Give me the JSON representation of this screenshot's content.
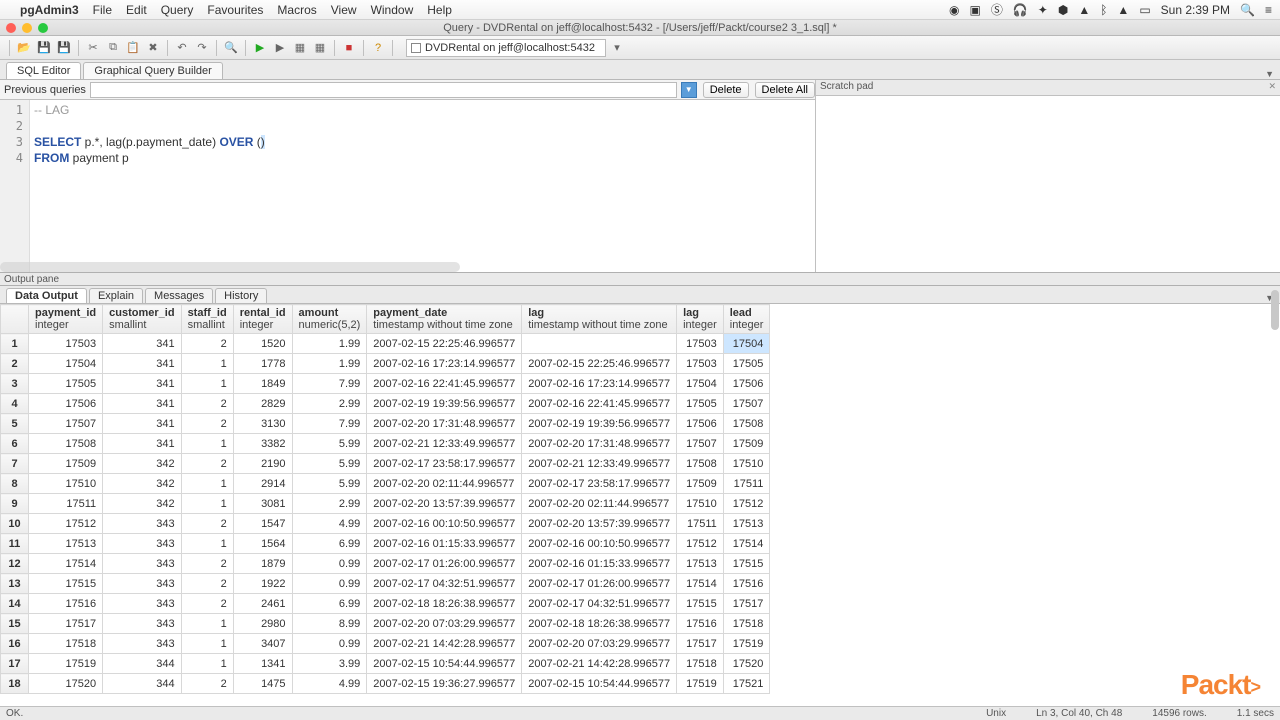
{
  "menubar": {
    "app": "pgAdmin3",
    "items": [
      "File",
      "Edit",
      "Query",
      "Favourites",
      "Macros",
      "View",
      "Window",
      "Help"
    ],
    "clock": "Sun 2:39 PM"
  },
  "window": {
    "title": "Query - DVDRental on jeff@localhost:5432 - [/Users/jeff/Packt/course2 3_1.sql] *"
  },
  "db_selector": "DVDRental on jeff@localhost:5432",
  "editor_tabs": {
    "sql": "SQL Editor",
    "gqb": "Graphical Query Builder"
  },
  "prev": {
    "label": "Previous queries",
    "delete": "Delete",
    "delete_all": "Delete All"
  },
  "code": {
    "l1": "-- LAG",
    "l2": "",
    "l3a": "SELECT",
    "l3b": " p.*, lag(p.payment_date) ",
    "l3c": "OVER",
    "l3d": " (",
    "l3e": ")",
    "l4a": "FROM",
    "l4b": " payment p"
  },
  "scratch": {
    "title": "Scratch pad"
  },
  "output": {
    "label": "Output pane"
  },
  "output_tabs": {
    "data": "Data Output",
    "explain": "Explain",
    "messages": "Messages",
    "history": "History"
  },
  "columns": [
    {
      "name": "payment_id",
      "type": "integer"
    },
    {
      "name": "customer_id",
      "type": "smallint"
    },
    {
      "name": "staff_id",
      "type": "smallint"
    },
    {
      "name": "rental_id",
      "type": "integer"
    },
    {
      "name": "amount",
      "type": "numeric(5,2)"
    },
    {
      "name": "payment_date",
      "type": "timestamp without time zone"
    },
    {
      "name": "lag",
      "type": "timestamp without time zone"
    },
    {
      "name": "lag",
      "type": "integer"
    },
    {
      "name": "lead",
      "type": "integer"
    }
  ],
  "rows": [
    [
      17503,
      341,
      2,
      1520,
      "1.99",
      "2007-02-15 22:25:46.996577",
      "",
      17503,
      17504
    ],
    [
      17504,
      341,
      1,
      1778,
      "1.99",
      "2007-02-16 17:23:14.996577",
      "2007-02-15 22:25:46.996577",
      17503,
      17505
    ],
    [
      17505,
      341,
      1,
      1849,
      "7.99",
      "2007-02-16 22:41:45.996577",
      "2007-02-16 17:23:14.996577",
      17504,
      17506
    ],
    [
      17506,
      341,
      2,
      2829,
      "2.99",
      "2007-02-19 19:39:56.996577",
      "2007-02-16 22:41:45.996577",
      17505,
      17507
    ],
    [
      17507,
      341,
      2,
      3130,
      "7.99",
      "2007-02-20 17:31:48.996577",
      "2007-02-19 19:39:56.996577",
      17506,
      17508
    ],
    [
      17508,
      341,
      1,
      3382,
      "5.99",
      "2007-02-21 12:33:49.996577",
      "2007-02-20 17:31:48.996577",
      17507,
      17509
    ],
    [
      17509,
      342,
      2,
      2190,
      "5.99",
      "2007-02-17 23:58:17.996577",
      "2007-02-21 12:33:49.996577",
      17508,
      17510
    ],
    [
      17510,
      342,
      1,
      2914,
      "5.99",
      "2007-02-20 02:11:44.996577",
      "2007-02-17 23:58:17.996577",
      17509,
      17511
    ],
    [
      17511,
      342,
      1,
      3081,
      "2.99",
      "2007-02-20 13:57:39.996577",
      "2007-02-20 02:11:44.996577",
      17510,
      17512
    ],
    [
      17512,
      343,
      2,
      1547,
      "4.99",
      "2007-02-16 00:10:50.996577",
      "2007-02-20 13:57:39.996577",
      17511,
      17513
    ],
    [
      17513,
      343,
      1,
      1564,
      "6.99",
      "2007-02-16 01:15:33.996577",
      "2007-02-16 00:10:50.996577",
      17512,
      17514
    ],
    [
      17514,
      343,
      2,
      1879,
      "0.99",
      "2007-02-17 01:26:00.996577",
      "2007-02-16 01:15:33.996577",
      17513,
      17515
    ],
    [
      17515,
      343,
      2,
      1922,
      "0.99",
      "2007-02-17 04:32:51.996577",
      "2007-02-17 01:26:00.996577",
      17514,
      17516
    ],
    [
      17516,
      343,
      2,
      2461,
      "6.99",
      "2007-02-18 18:26:38.996577",
      "2007-02-17 04:32:51.996577",
      17515,
      17517
    ],
    [
      17517,
      343,
      1,
      2980,
      "8.99",
      "2007-02-20 07:03:29.996577",
      "2007-02-18 18:26:38.996577",
      17516,
      17518
    ],
    [
      17518,
      343,
      1,
      3407,
      "0.99",
      "2007-02-21 14:42:28.996577",
      "2007-02-20 07:03:29.996577",
      17517,
      17519
    ],
    [
      17519,
      344,
      1,
      1341,
      "3.99",
      "2007-02-15 10:54:44.996577",
      "2007-02-21 14:42:28.996577",
      17518,
      17520
    ],
    [
      17520,
      344,
      2,
      1475,
      "4.99",
      "2007-02-15 19:36:27.996577",
      "2007-02-15 10:54:44.996577",
      17519,
      17521
    ]
  ],
  "status": {
    "ok": "OK.",
    "enc": "Unix",
    "pos": "Ln 3, Col 40, Ch 48",
    "rows": "14596 rows.",
    "time": "1.1 secs"
  },
  "wm": "Packt"
}
